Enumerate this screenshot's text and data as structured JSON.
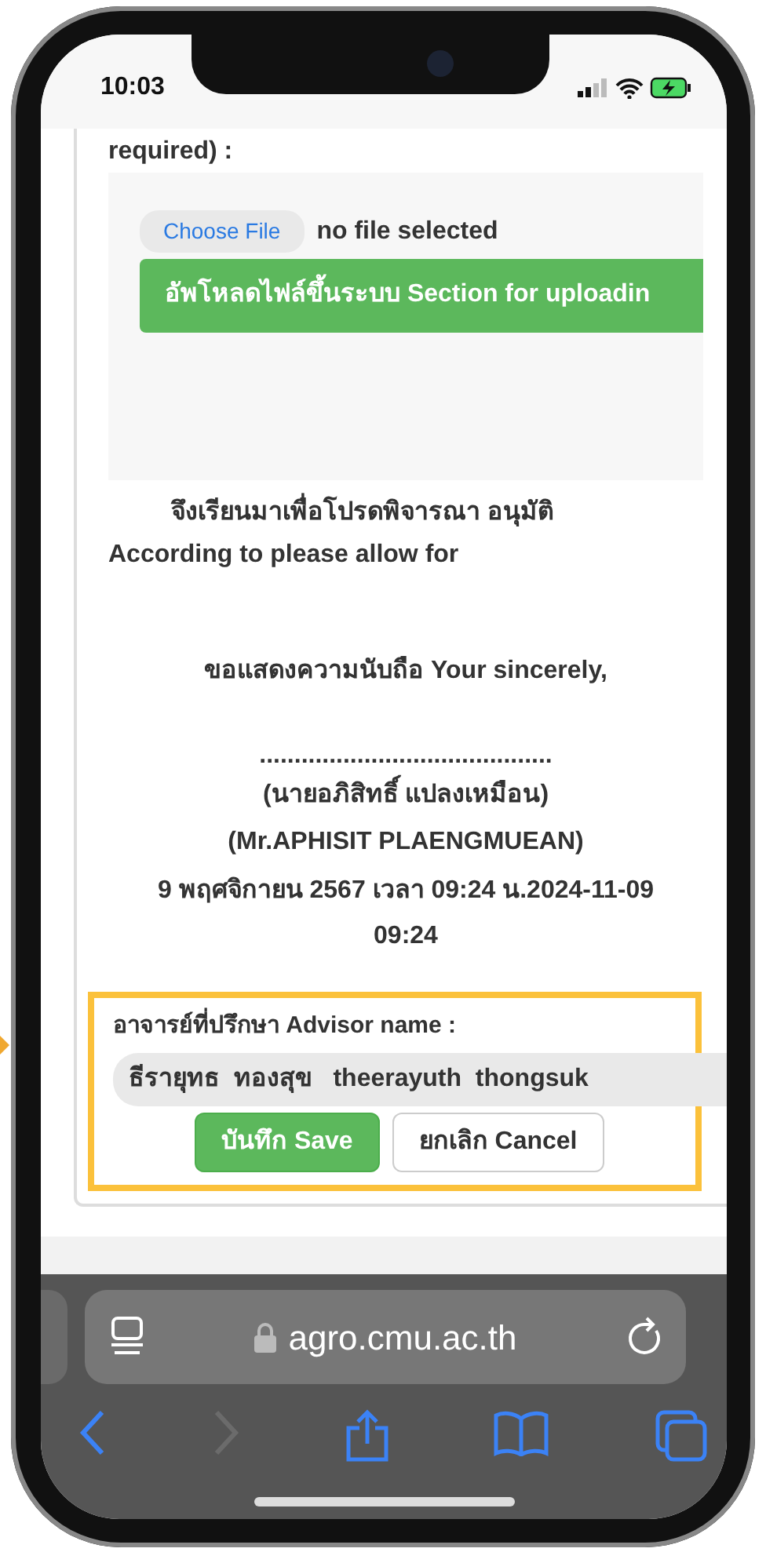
{
  "status_bar": {
    "time": "10:03"
  },
  "form": {
    "field_label": "required) :",
    "file_input": {
      "button": "Choose File",
      "status": "no file selected"
    },
    "upload_button": "อัพโหลดไฟล์ขึ้นระบบ Section for uploadin",
    "closing_lines": [
      {
        "text": "จึงเรียนมาเพื่อโปรดพิจารณา อนุมัติ",
        "kind": "indent"
      },
      {
        "text": "According to please allow for",
        "kind": "plain"
      }
    ],
    "signoff": "ขอแสดงความนับถือ Your sincerely,",
    "signature_line": "..........................................",
    "signer_thai": "(นายอภิสิทธิ์ แปลงเหมือน)",
    "signer_english": "(Mr.APHISIT PLAENGMUEAN)",
    "signed_at": "9 พฤศจิกายน 2567 เวลา 09:24 น.2024-11-09 09:24",
    "advisor": {
      "label": "อาจารย์ที่ปรึกษา Advisor name :",
      "value": "ธีรายุทธ  ทองสุข   theerayuth  thongsuk",
      "highlighted": true
    },
    "buttons": [
      {
        "label": "บันทึก Save",
        "kind": "primary"
      },
      {
        "label": "ยกเลิก Cancel",
        "kind": "secondary"
      }
    ]
  },
  "browser": {
    "url": "agro.cmu.ac.th"
  }
}
